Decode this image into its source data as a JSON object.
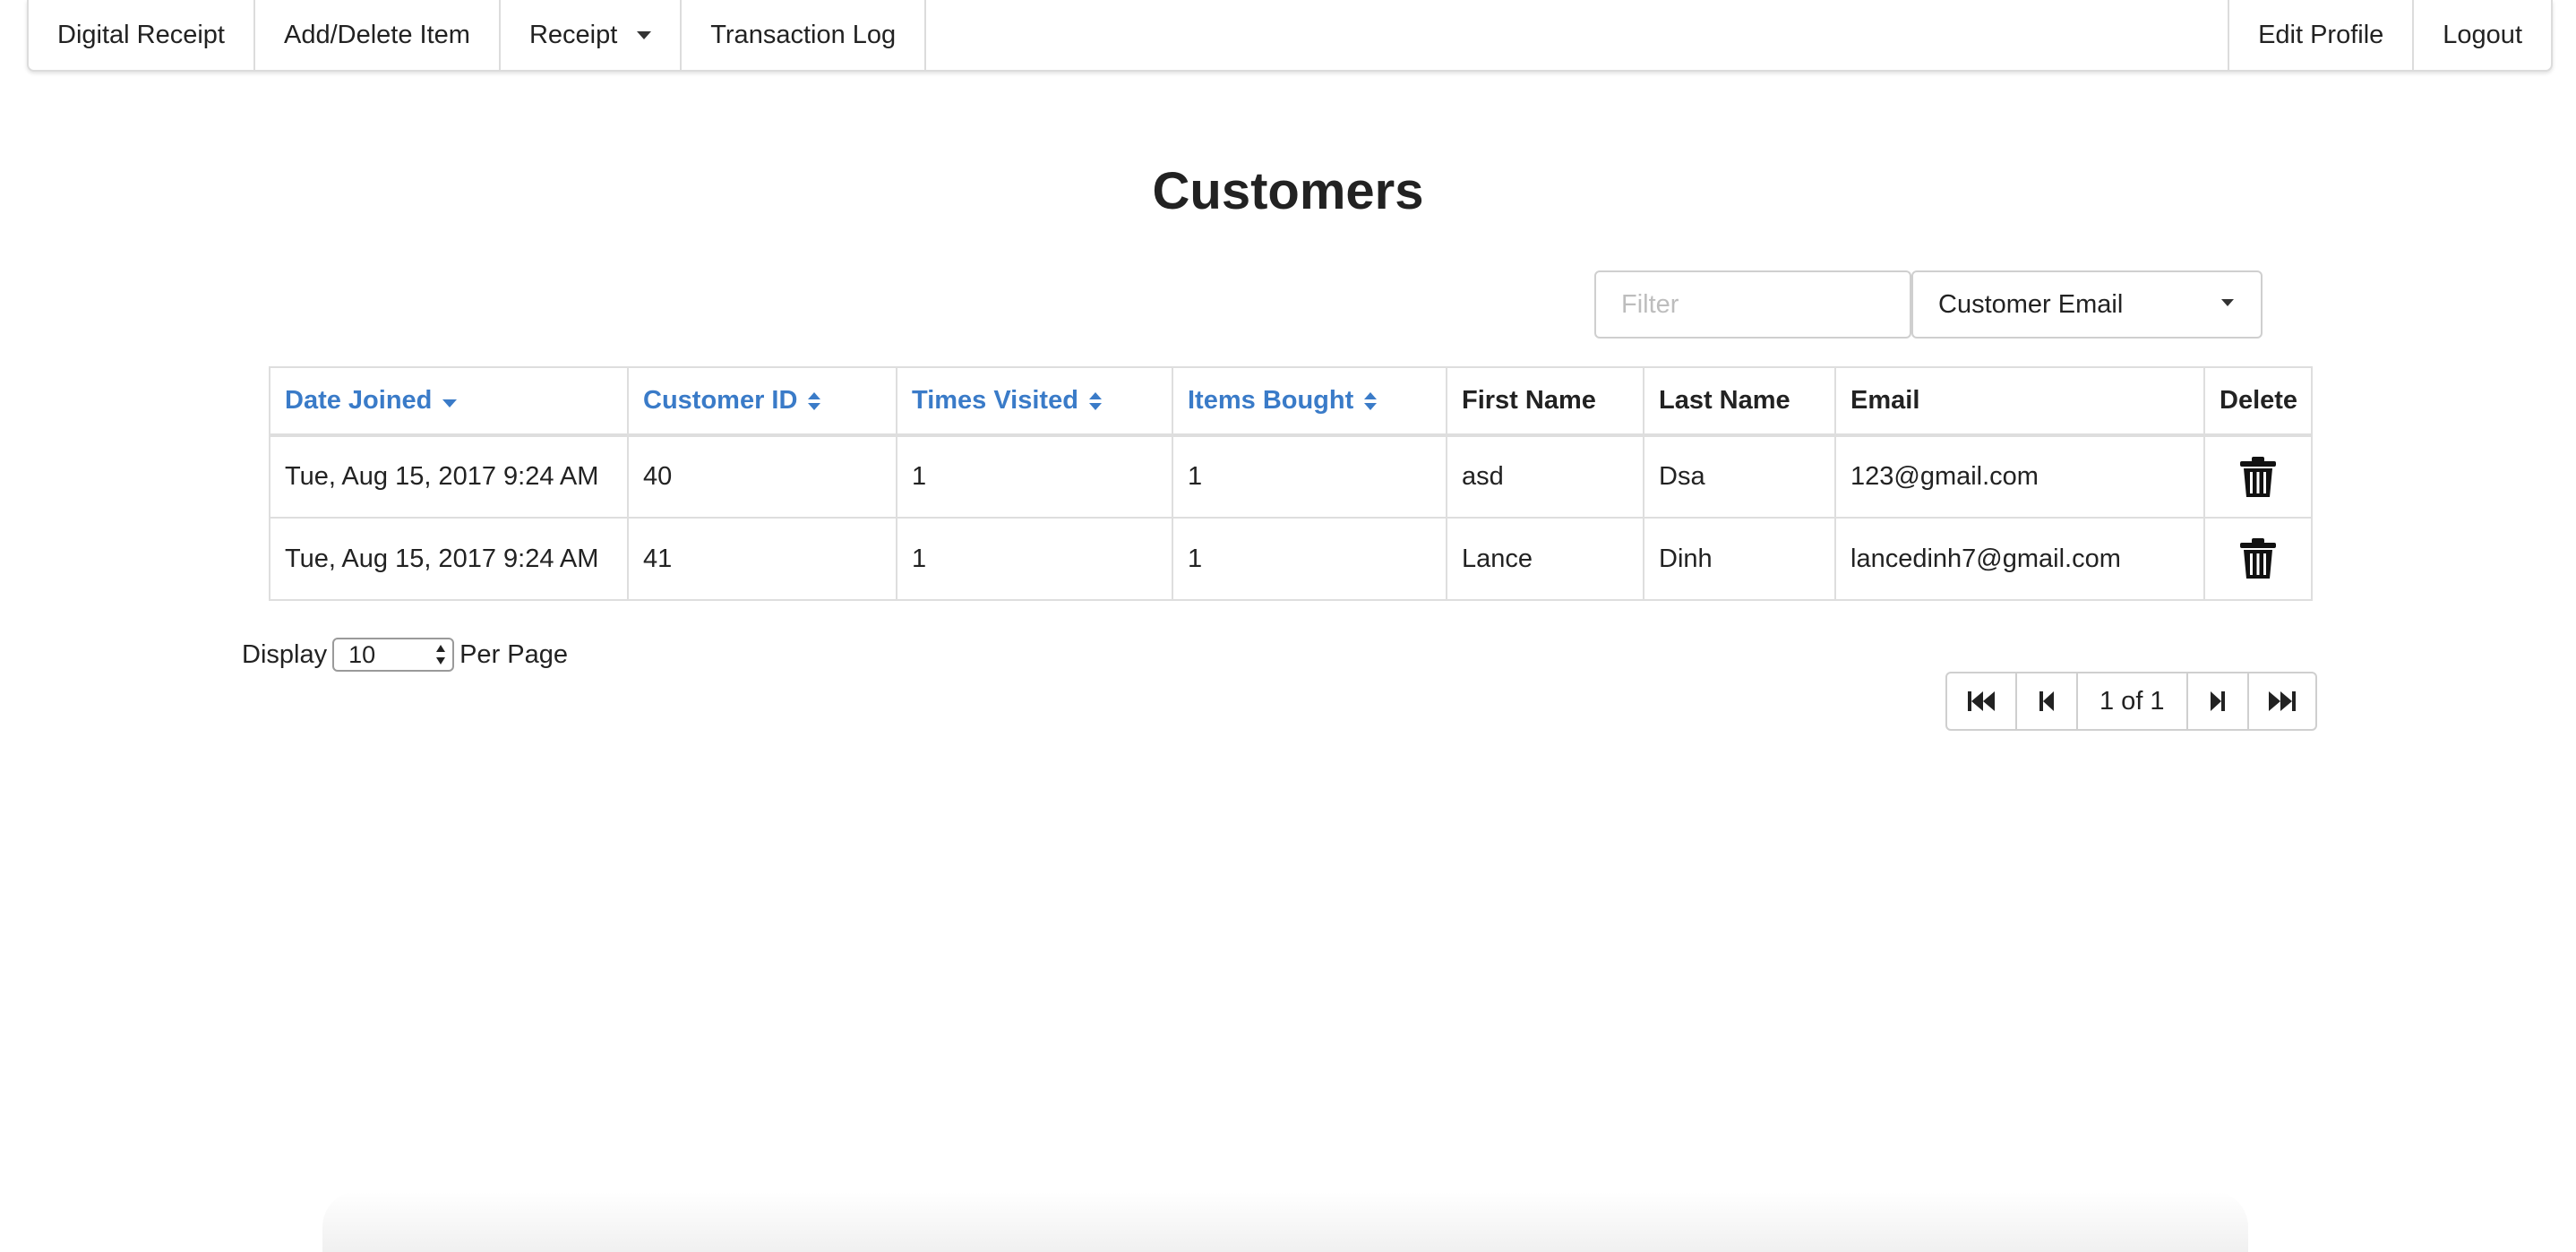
{
  "nav": {
    "left": [
      {
        "label": "Digital Receipt"
      },
      {
        "label": "Add/Delete Item"
      },
      {
        "label": "Receipt"
      },
      {
        "label": "Transaction Log"
      }
    ],
    "right": [
      {
        "label": "Edit Profile"
      },
      {
        "label": "Logout"
      }
    ]
  },
  "page": {
    "title": "Customers"
  },
  "filter": {
    "placeholder": "Filter",
    "value": "",
    "field_selected": "Customer Email"
  },
  "table": {
    "columns": [
      {
        "label": "Date Joined",
        "sortable": true,
        "sort": "desc"
      },
      {
        "label": "Customer ID",
        "sortable": true,
        "sort": "none"
      },
      {
        "label": "Times Visited",
        "sortable": true,
        "sort": "none"
      },
      {
        "label": "Items Bought",
        "sortable": true,
        "sort": "none"
      },
      {
        "label": "First Name",
        "sortable": false
      },
      {
        "label": "Last Name",
        "sortable": false
      },
      {
        "label": "Email",
        "sortable": false
      },
      {
        "label": "Delete",
        "sortable": false
      }
    ],
    "rows": [
      {
        "date_joined": "Tue, Aug 15, 2017 9:24 AM",
        "customer_id": "40",
        "times_visited": "1",
        "items_bought": "1",
        "first_name": "asd",
        "last_name": "Dsa",
        "email": "123@gmail.com",
        "delete_icon": "trash-icon"
      },
      {
        "date_joined": "Tue, Aug 15, 2017 9:24 AM",
        "customer_id": "41",
        "times_visited": "1",
        "items_bought": "1",
        "first_name": "Lance",
        "last_name": "Dinh",
        "email": "lancedinh7@gmail.com",
        "delete_icon": "trash-icon"
      }
    ]
  },
  "per_page": {
    "prefix": "Display",
    "value": "10",
    "suffix": "Per Page"
  },
  "pagination": {
    "info": "1 of 1",
    "icons": [
      "first-page-icon",
      "prev-page-icon",
      "next-page-icon",
      "last-page-icon"
    ]
  },
  "colors": {
    "link": "#3a7bc8",
    "border": "#dedede",
    "text": "#222222"
  }
}
